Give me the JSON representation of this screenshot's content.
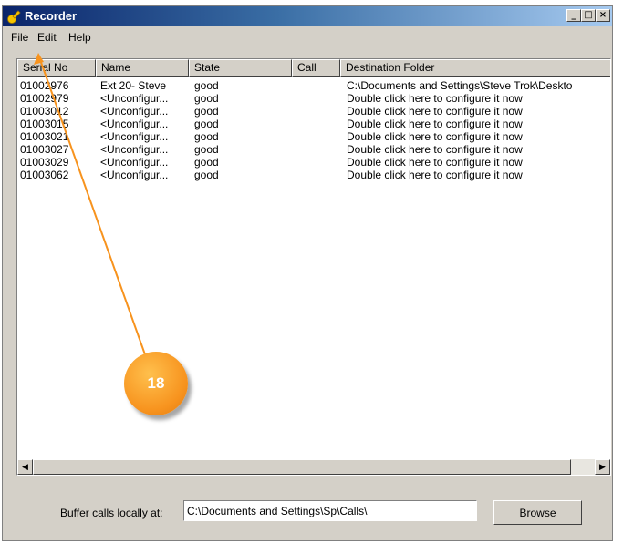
{
  "window": {
    "title": "Recorder",
    "buttons": [
      "_",
      "□",
      "×"
    ]
  },
  "menu": [
    "File",
    "Edit",
    "Help"
  ],
  "columns": [
    "Serial No",
    "Name",
    "State",
    "Call",
    "Destination Folder"
  ],
  "rows": [
    {
      "serial": "01002976",
      "name": "Ext 20- Steve",
      "state": "good",
      "call": "",
      "dest": "C:\\Documents and Settings\\Steve Trok\\Deskto"
    },
    {
      "serial": "01002979",
      "name": "<Unconfigur...",
      "state": "good",
      "call": "",
      "dest": "Double click here to configure it now"
    },
    {
      "serial": "01003012",
      "name": "<Unconfigur...",
      "state": "good",
      "call": "",
      "dest": "Double click here to configure it now"
    },
    {
      "serial": "01003015",
      "name": "<Unconfigur...",
      "state": "good",
      "call": "",
      "dest": "Double click here to configure it now"
    },
    {
      "serial": "01003021",
      "name": "<Unconfigur...",
      "state": "good",
      "call": "",
      "dest": "Double click here to configure it now"
    },
    {
      "serial": "01003027",
      "name": "<Unconfigur...",
      "state": "good",
      "call": "",
      "dest": "Double click here to configure it now"
    },
    {
      "serial": "01003029",
      "name": "<Unconfigur...",
      "state": "good",
      "call": "",
      "dest": "Double click here to configure it now"
    },
    {
      "serial": "01003062",
      "name": "<Unconfigur...",
      "state": "good",
      "call": "",
      "dest": "Double click here to configure it now"
    }
  ],
  "buffer": {
    "label": "Buffer calls locally at:",
    "value": "C:\\Documents and Settings\\Sp\\Calls\\",
    "browse_label": "Browse"
  },
  "callout": {
    "number": "18",
    "color": "#f7931e"
  }
}
